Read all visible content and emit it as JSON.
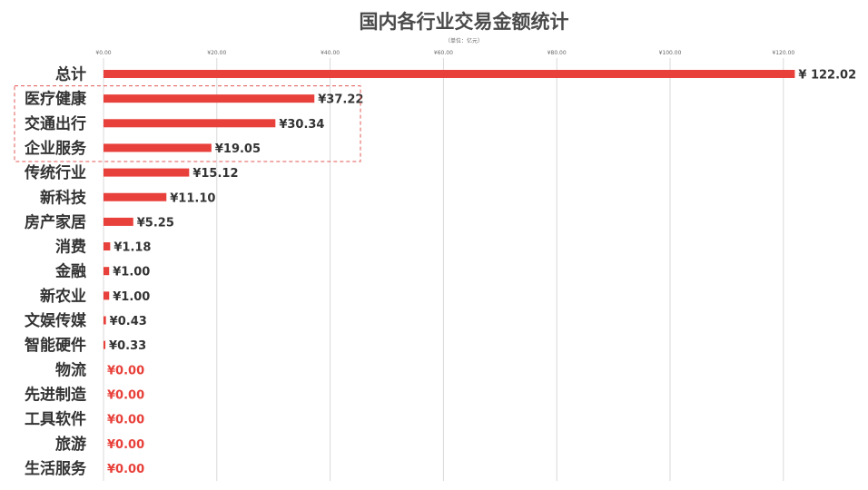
{
  "chart_data": {
    "type": "bar",
    "orientation": "horizontal",
    "title": "国内各行业交易金额统计",
    "unit_note": "（单位：亿元）",
    "xlim": [
      0,
      125
    ],
    "x_ticks": [
      {
        "value": 0,
        "label": "¥0.00"
      },
      {
        "value": 20,
        "label": "¥20.00"
      },
      {
        "value": 40,
        "label": "¥40.00"
      },
      {
        "value": 60,
        "label": "¥60.00"
      },
      {
        "value": 80,
        "label": "¥80.00"
      },
      {
        "value": 100,
        "label": "¥100.00"
      },
      {
        "value": 120,
        "label": "¥120.00"
      }
    ],
    "grid": true,
    "bar_color": "#e8403a",
    "zero_label_color": "#e8403a",
    "highlight": {
      "categories": [
        "医疗健康",
        "交通出行",
        "企业服务"
      ],
      "style": "dashed",
      "color": "#e05a55"
    },
    "categories": [
      "总计",
      "医疗健康",
      "交通出行",
      "企业服务",
      "传统行业",
      "新科技",
      "房产家居",
      "消费",
      "金融",
      "新农业",
      "文娱传媒",
      "智能硬件",
      "物流",
      "先进制造",
      "工具软件",
      "旅游",
      "生活服务"
    ],
    "values": [
      122.02,
      37.22,
      30.34,
      19.05,
      15.12,
      11.1,
      5.25,
      1.18,
      1.0,
      1.0,
      0.43,
      0.33,
      0,
      0,
      0,
      0,
      0
    ],
    "value_labels": [
      "¥ 122.02",
      "¥37.22",
      "¥30.34",
      "¥19.05",
      "¥15.12",
      "¥11.10",
      "¥5.25",
      "¥1.18",
      "¥1.00",
      "¥1.00",
      "¥0.43",
      "¥0.33",
      "¥0.00",
      "¥0.00",
      "¥0.00",
      "¥0.00",
      "¥0.00"
    ]
  }
}
